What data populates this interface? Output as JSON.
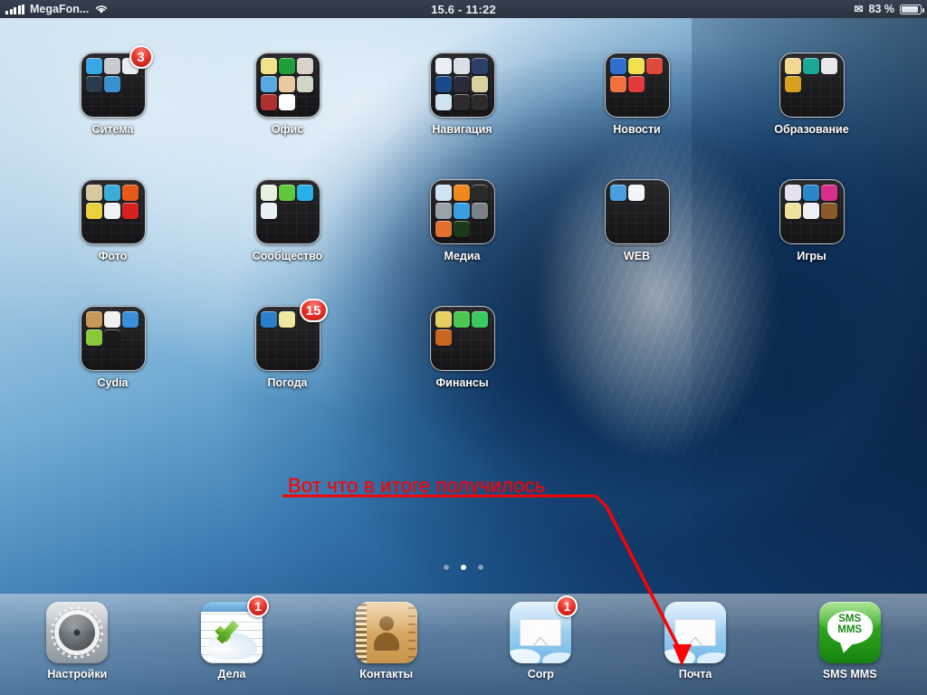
{
  "status_bar": {
    "carrier": "MegaFon...",
    "signal_icon": "signal-bars-icon",
    "wifi_icon": "wifi-icon",
    "datetime": "15.6 - 11:22",
    "mail_icon": "envelope-icon",
    "battery_percent": "83 %",
    "battery_icon": "battery-icon"
  },
  "home_screen": {
    "rows": [
      {
        "cells": [
          {
            "name": "Ситема",
            "badge": "3",
            "minis": [
              "#3aa6e8",
              "#c6ccd2",
              "#e8eef4",
              "#2a3b4c",
              "#3a8fd0"
            ]
          },
          {
            "name": "Офис",
            "badge": null,
            "minis": [
              "#f0e08a",
              "#1f9e3a",
              "#d8d2c8",
              "#5aa8e0",
              "#e8c9a0",
              "#cfd6c4",
              "#b03030",
              "#ffffff"
            ]
          },
          {
            "name": "Навигация",
            "badge": null,
            "minis": [
              "#e8eef4",
              "#d8dfe6",
              "#2b3f6b",
              "#1a4a8a",
              "#2a2a3a",
              "#d8d0a0",
              "#cfe4f2",
              "#2c2c2c",
              "#2c2c2c"
            ]
          },
          {
            "name": "Новости",
            "badge": null,
            "minis": [
              "#2f6fd0",
              "#f2e050",
              "#e04a3a",
              "#f07040",
              "#e03a3a"
            ]
          },
          {
            "name": "Образование",
            "badge": null,
            "minis": [
              "#f0d890",
              "#1aa898",
              "#e8e8ec",
              "#d8a020"
            ]
          }
        ]
      },
      {
        "cells": [
          {
            "name": "Фото",
            "badge": null,
            "minis": [
              "#d8c8a0",
              "#3aaed8",
              "#e85a18",
              "#e8d040",
              "#f0f2f4",
              "#d82020"
            ]
          },
          {
            "name": "Сообщество",
            "badge": null,
            "minis": [
              "#e8f0e0",
              "#5ec83a",
              "#28b0e8",
              "#e8f0f4"
            ]
          },
          {
            "name": "Медиа",
            "badge": null,
            "minis": [
              "#cfe4f2",
              "#f08820",
              "#2a2a2a",
              "#9aa2aa",
              "#3a9fe0",
              "#7a8288",
              "#e07030",
              "#1a3a1a"
            ]
          },
          {
            "name": "WEB",
            "badge": null,
            "minis": [
              "#4a9fe0",
              "#f2f4f6"
            ]
          },
          {
            "name": "Игры",
            "badge": null,
            "minis": [
              "#e8e0f0",
              "#2a88c8",
              "#d8308a",
              "#f0e0a0",
              "#f0f0f4",
              "#8a5a28"
            ]
          }
        ]
      },
      {
        "cells": [
          {
            "name": "Cydia",
            "badge": null,
            "minis": [
              "#c89858",
              "#f0f0f0",
              "#3a8fd8",
              "#8ac83a",
              "#1a1a1a"
            ]
          },
          {
            "name": "Погода",
            "badge": "15",
            "minis": [
              "#2a7fc8",
              "#f0e8a0"
            ]
          },
          {
            "name": "Финансы",
            "badge": null,
            "minis": [
              "#e8d060",
              "#4ac850",
              "#3ac860",
              "#c86820"
            ]
          }
        ]
      }
    ],
    "page_dots": {
      "count": 3,
      "active_index": 1
    }
  },
  "annotation": {
    "text": "Вот что в итоге получилось",
    "color": "#ff0000",
    "arrow_target": "Почта"
  },
  "dock": {
    "items": [
      {
        "label": "Настройки",
        "icon": "gear-icon",
        "badge": null
      },
      {
        "label": "Дела",
        "icon": "calendar-check-icon",
        "badge": "1"
      },
      {
        "label": "Контакты",
        "icon": "address-book-icon",
        "badge": null
      },
      {
        "label": "Corp",
        "icon": "mail-envelope-icon",
        "badge": "1"
      },
      {
        "label": "Почта",
        "icon": "mail-envelope-icon",
        "badge": null
      },
      {
        "label": "SMS MMS",
        "icon": "sms-bubble-icon",
        "badge": null,
        "bubble_line1": "SMS",
        "bubble_line2": "MMS"
      }
    ]
  }
}
